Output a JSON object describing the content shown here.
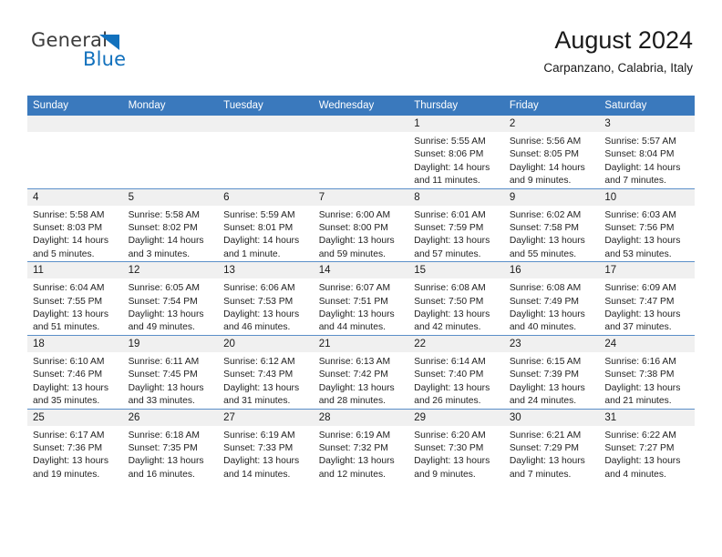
{
  "brand": {
    "name_top": "General",
    "name_bottom": "Blue",
    "accent_color": "#1271bd",
    "triangle_icon": "triangle-icon"
  },
  "header": {
    "title": "August 2024",
    "subtitle": "Carpanzano, Calabria, Italy"
  },
  "calendar": {
    "header_bg": "#3a79bd",
    "daynum_bg": "#f0f0f0",
    "grid_line": "#5b8fc9",
    "weekday_headers": [
      "Sunday",
      "Monday",
      "Tuesday",
      "Wednesday",
      "Thursday",
      "Friday",
      "Saturday"
    ],
    "weeks": [
      [
        {
          "day": "",
          "empty": true,
          "lines": []
        },
        {
          "day": "",
          "empty": true,
          "lines": []
        },
        {
          "day": "",
          "empty": true,
          "lines": []
        },
        {
          "day": "",
          "empty": true,
          "lines": []
        },
        {
          "day": "1",
          "lines": [
            "Sunrise: 5:55 AM",
            "Sunset: 8:06 PM",
            "Daylight: 14 hours",
            "and 11 minutes."
          ]
        },
        {
          "day": "2",
          "lines": [
            "Sunrise: 5:56 AM",
            "Sunset: 8:05 PM",
            "Daylight: 14 hours",
            "and 9 minutes."
          ]
        },
        {
          "day": "3",
          "lines": [
            "Sunrise: 5:57 AM",
            "Sunset: 8:04 PM",
            "Daylight: 14 hours",
            "and 7 minutes."
          ]
        }
      ],
      [
        {
          "day": "4",
          "lines": [
            "Sunrise: 5:58 AM",
            "Sunset: 8:03 PM",
            "Daylight: 14 hours",
            "and 5 minutes."
          ]
        },
        {
          "day": "5",
          "lines": [
            "Sunrise: 5:58 AM",
            "Sunset: 8:02 PM",
            "Daylight: 14 hours",
            "and 3 minutes."
          ]
        },
        {
          "day": "6",
          "lines": [
            "Sunrise: 5:59 AM",
            "Sunset: 8:01 PM",
            "Daylight: 14 hours",
            "and 1 minute."
          ]
        },
        {
          "day": "7",
          "lines": [
            "Sunrise: 6:00 AM",
            "Sunset: 8:00 PM",
            "Daylight: 13 hours",
            "and 59 minutes."
          ]
        },
        {
          "day": "8",
          "lines": [
            "Sunrise: 6:01 AM",
            "Sunset: 7:59 PM",
            "Daylight: 13 hours",
            "and 57 minutes."
          ]
        },
        {
          "day": "9",
          "lines": [
            "Sunrise: 6:02 AM",
            "Sunset: 7:58 PM",
            "Daylight: 13 hours",
            "and 55 minutes."
          ]
        },
        {
          "day": "10",
          "lines": [
            "Sunrise: 6:03 AM",
            "Sunset: 7:56 PM",
            "Daylight: 13 hours",
            "and 53 minutes."
          ]
        }
      ],
      [
        {
          "day": "11",
          "lines": [
            "Sunrise: 6:04 AM",
            "Sunset: 7:55 PM",
            "Daylight: 13 hours",
            "and 51 minutes."
          ]
        },
        {
          "day": "12",
          "lines": [
            "Sunrise: 6:05 AM",
            "Sunset: 7:54 PM",
            "Daylight: 13 hours",
            "and 49 minutes."
          ]
        },
        {
          "day": "13",
          "lines": [
            "Sunrise: 6:06 AM",
            "Sunset: 7:53 PM",
            "Daylight: 13 hours",
            "and 46 minutes."
          ]
        },
        {
          "day": "14",
          "lines": [
            "Sunrise: 6:07 AM",
            "Sunset: 7:51 PM",
            "Daylight: 13 hours",
            "and 44 minutes."
          ]
        },
        {
          "day": "15",
          "lines": [
            "Sunrise: 6:08 AM",
            "Sunset: 7:50 PM",
            "Daylight: 13 hours",
            "and 42 minutes."
          ]
        },
        {
          "day": "16",
          "lines": [
            "Sunrise: 6:08 AM",
            "Sunset: 7:49 PM",
            "Daylight: 13 hours",
            "and 40 minutes."
          ]
        },
        {
          "day": "17",
          "lines": [
            "Sunrise: 6:09 AM",
            "Sunset: 7:47 PM",
            "Daylight: 13 hours",
            "and 37 minutes."
          ]
        }
      ],
      [
        {
          "day": "18",
          "lines": [
            "Sunrise: 6:10 AM",
            "Sunset: 7:46 PM",
            "Daylight: 13 hours",
            "and 35 minutes."
          ]
        },
        {
          "day": "19",
          "lines": [
            "Sunrise: 6:11 AM",
            "Sunset: 7:45 PM",
            "Daylight: 13 hours",
            "and 33 minutes."
          ]
        },
        {
          "day": "20",
          "lines": [
            "Sunrise: 6:12 AM",
            "Sunset: 7:43 PM",
            "Daylight: 13 hours",
            "and 31 minutes."
          ]
        },
        {
          "day": "21",
          "lines": [
            "Sunrise: 6:13 AM",
            "Sunset: 7:42 PM",
            "Daylight: 13 hours",
            "and 28 minutes."
          ]
        },
        {
          "day": "22",
          "lines": [
            "Sunrise: 6:14 AM",
            "Sunset: 7:40 PM",
            "Daylight: 13 hours",
            "and 26 minutes."
          ]
        },
        {
          "day": "23",
          "lines": [
            "Sunrise: 6:15 AM",
            "Sunset: 7:39 PM",
            "Daylight: 13 hours",
            "and 24 minutes."
          ]
        },
        {
          "day": "24",
          "lines": [
            "Sunrise: 6:16 AM",
            "Sunset: 7:38 PM",
            "Daylight: 13 hours",
            "and 21 minutes."
          ]
        }
      ],
      [
        {
          "day": "25",
          "lines": [
            "Sunrise: 6:17 AM",
            "Sunset: 7:36 PM",
            "Daylight: 13 hours",
            "and 19 minutes."
          ]
        },
        {
          "day": "26",
          "lines": [
            "Sunrise: 6:18 AM",
            "Sunset: 7:35 PM",
            "Daylight: 13 hours",
            "and 16 minutes."
          ]
        },
        {
          "day": "27",
          "lines": [
            "Sunrise: 6:19 AM",
            "Sunset: 7:33 PM",
            "Daylight: 13 hours",
            "and 14 minutes."
          ]
        },
        {
          "day": "28",
          "lines": [
            "Sunrise: 6:19 AM",
            "Sunset: 7:32 PM",
            "Daylight: 13 hours",
            "and 12 minutes."
          ]
        },
        {
          "day": "29",
          "lines": [
            "Sunrise: 6:20 AM",
            "Sunset: 7:30 PM",
            "Daylight: 13 hours",
            "and 9 minutes."
          ]
        },
        {
          "day": "30",
          "lines": [
            "Sunrise: 6:21 AM",
            "Sunset: 7:29 PM",
            "Daylight: 13 hours",
            "and 7 minutes."
          ]
        },
        {
          "day": "31",
          "lines": [
            "Sunrise: 6:22 AM",
            "Sunset: 7:27 PM",
            "Daylight: 13 hours",
            "and 4 minutes."
          ]
        }
      ]
    ]
  }
}
